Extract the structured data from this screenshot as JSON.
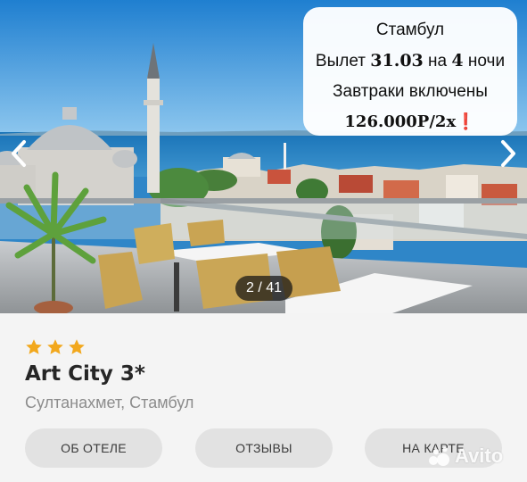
{
  "gallery": {
    "counter": "2 / 41",
    "prev_icon": "chevron-left-icon",
    "next_icon": "chevron-right-icon"
  },
  "promo": {
    "city": "Стамбул",
    "departure_prefix": "Вылет ",
    "departure_date": "31.03",
    "departure_mid": " на ",
    "nights_count": "4",
    "nights_suffix": " ночи",
    "breakfast": "Завтраки включены",
    "price": "126.000Р/2х",
    "price_mark": "❗"
  },
  "hotel": {
    "rating_stars": 3,
    "star_color": "#f2a81d",
    "name": "Art City 3*",
    "location": "Султанахмет, Стамбул"
  },
  "actions": {
    "about": "ОБ ОТЕЛЕ",
    "reviews": "ОТЗЫВЫ",
    "map": "НА КАРТЕ"
  },
  "watermark": {
    "text": "Avito",
    "icon": "avito-logo-icon"
  }
}
